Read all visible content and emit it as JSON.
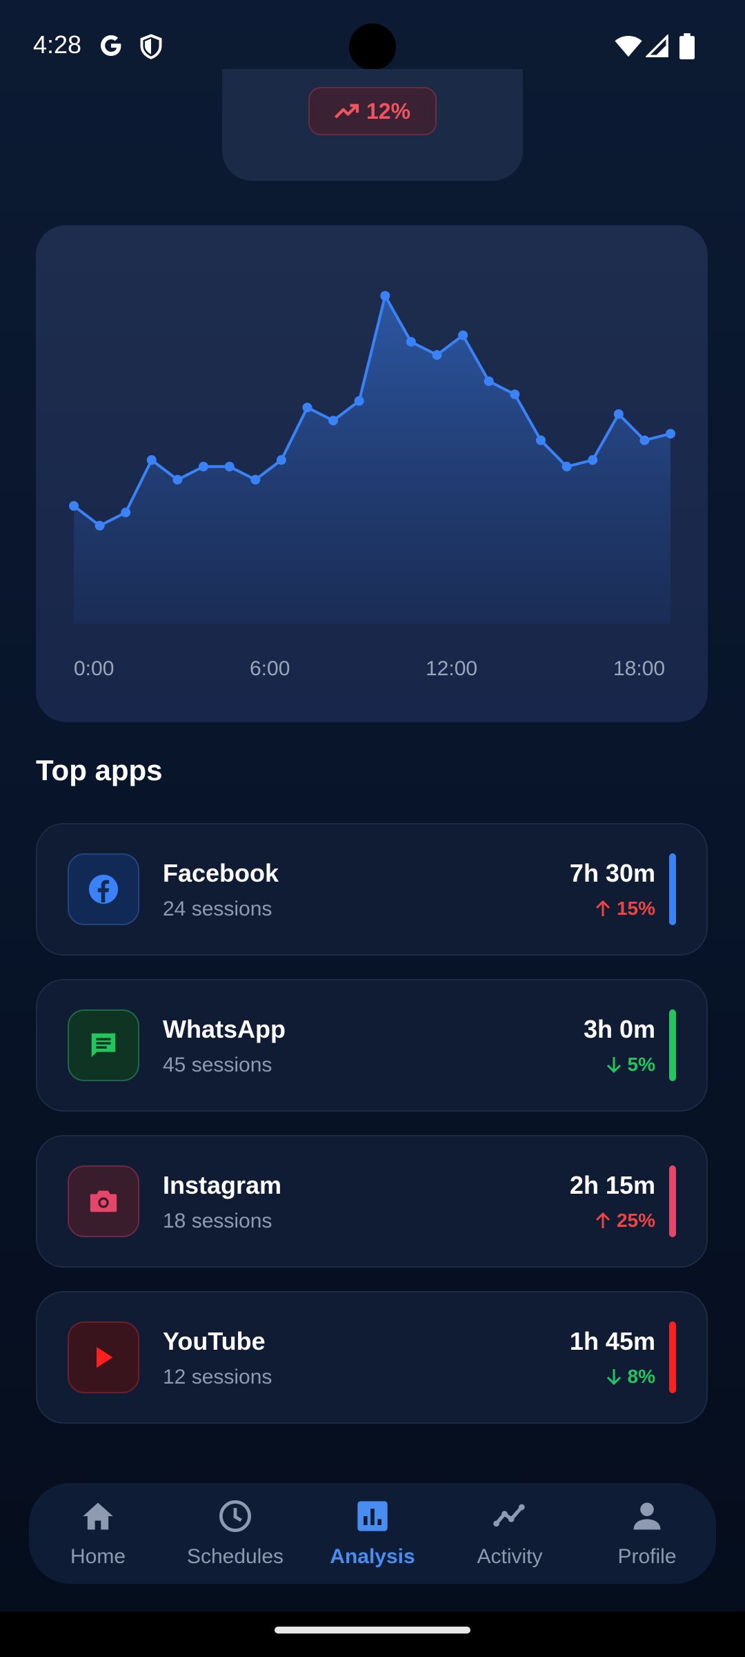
{
  "status_bar": {
    "time": "4:28"
  },
  "summary": {
    "change": "12%",
    "trend_icon": "trending-up-icon"
  },
  "usage_chart": {
    "x_ticks": [
      "0:00",
      "6:00",
      "12:00",
      "18:00"
    ],
    "line_color": "#3b82f6"
  },
  "chart_data": {
    "type": "area",
    "title": "",
    "xlabel": "",
    "ylabel": "",
    "x_labels": [
      "0:00",
      "6:00",
      "12:00",
      "18:00"
    ],
    "values": [
      36,
      30,
      34,
      50,
      44,
      48,
      48,
      44,
      50,
      66,
      62,
      68,
      100,
      86,
      82,
      88,
      74,
      70,
      56,
      48,
      50,
      64,
      56,
      58
    ],
    "ylim": [
      0,
      110
    ],
    "grid": false
  },
  "section_title": "Top apps",
  "apps": [
    {
      "name": "Facebook",
      "sessions": "24 sessions",
      "time": "7h 30m",
      "change": "15%",
      "direction": "up",
      "color": "#3b82f6",
      "icon": "facebook-icon"
    },
    {
      "name": "WhatsApp",
      "sessions": "45 sessions",
      "time": "3h 0m",
      "change": "5%",
      "direction": "down",
      "color": "#22c55e",
      "icon": "chat-icon"
    },
    {
      "name": "Instagram",
      "sessions": "18 sessions",
      "time": "2h 15m",
      "change": "25%",
      "direction": "up",
      "color": "#e5466a",
      "icon": "camera-icon"
    },
    {
      "name": "YouTube",
      "sessions": "12 sessions",
      "time": "1h 45m",
      "change": "8%",
      "direction": "down",
      "color": "#ff1f1f",
      "icon": "play-icon"
    }
  ],
  "nav": {
    "active": "Analysis",
    "items": [
      {
        "label": "Home",
        "icon": "home-icon"
      },
      {
        "label": "Schedules",
        "icon": "clock-icon"
      },
      {
        "label": "Analysis",
        "icon": "bar-chart-icon"
      },
      {
        "label": "Activity",
        "icon": "activity-icon"
      },
      {
        "label": "Profile",
        "icon": "person-icon"
      }
    ]
  }
}
